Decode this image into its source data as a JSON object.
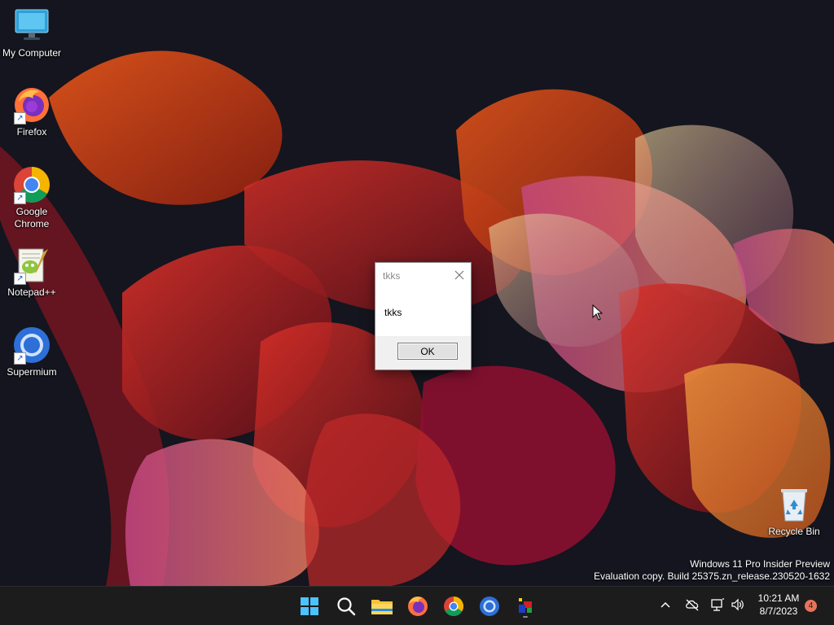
{
  "desktop": {
    "icons": [
      {
        "label": "My Computer",
        "icon": "computer-icon"
      },
      {
        "label": "Firefox",
        "icon": "firefox-icon"
      },
      {
        "label": "Google Chrome",
        "icon": "chrome-icon"
      },
      {
        "label": "Notepad++",
        "icon": "notepadpp-icon"
      },
      {
        "label": "Supermium",
        "icon": "supermium-icon"
      },
      {
        "label": "Recycle Bin",
        "icon": "recycle-bin-icon"
      }
    ]
  },
  "dialog": {
    "title": "tkks",
    "message": "tkks",
    "ok_label": "OK"
  },
  "watermark": {
    "line1": "Windows 11 Pro Insider Preview",
    "line2": "Evaluation copy. Build 25375.zn_release.230520-1632"
  },
  "taskbar": {
    "apps": [
      "start-icon",
      "search-icon",
      "file-explorer-icon",
      "firefox-icon",
      "chrome-icon",
      "supermium-icon",
      "app-icon"
    ],
    "clock": {
      "time": "10:21 AM",
      "date": "8/7/2023"
    },
    "notification_count": "4",
    "tray_icons": [
      "chevron-up-icon",
      "cloud-offline-icon",
      "network-icon",
      "volume-icon"
    ]
  },
  "colors": {
    "accent": "#0078d4",
    "taskbar_bg": "#1c1c1c",
    "wallpaper_bg": "#14151e",
    "notification_badge": "#e8735a"
  }
}
